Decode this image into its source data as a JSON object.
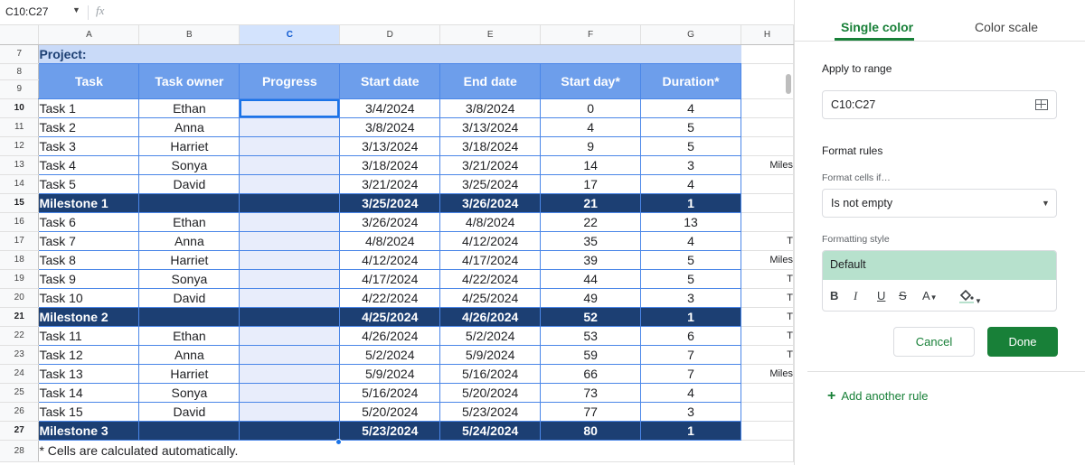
{
  "formula_bar": {
    "name_box": "C10:C27",
    "fx": "fx"
  },
  "columns": [
    "A",
    "B",
    "C",
    "D",
    "E",
    "F",
    "G",
    "H"
  ],
  "rows": {
    "project": {
      "num": "7",
      "label": "Project:"
    },
    "blank8": {
      "num": "8"
    },
    "header": {
      "num": "9",
      "cells": [
        "Task",
        "Task owner",
        "Progress",
        "Start date",
        "End date",
        "Start day*",
        "Duration*"
      ]
    },
    "data": [
      {
        "num": "10",
        "task": "Task 1",
        "owner": "Ethan",
        "start": "3/4/2024",
        "end": "3/8/2024",
        "day": "0",
        "dur": "4",
        "h": ""
      },
      {
        "num": "11",
        "task": "Task 2",
        "owner": "Anna",
        "start": "3/8/2024",
        "end": "3/13/2024",
        "day": "4",
        "dur": "5",
        "h": ""
      },
      {
        "num": "12",
        "task": "Task 3",
        "owner": "Harriet",
        "start": "3/13/2024",
        "end": "3/18/2024",
        "day": "9",
        "dur": "5",
        "h": ""
      },
      {
        "num": "13",
        "task": "Task 4",
        "owner": "Sonya",
        "start": "3/18/2024",
        "end": "3/21/2024",
        "day": "14",
        "dur": "3",
        "h": ""
      },
      {
        "num": "14",
        "task": "Task 5",
        "owner": "David",
        "start": "3/21/2024",
        "end": "3/25/2024",
        "day": "17",
        "dur": "4",
        "h": ""
      },
      {
        "num": "15",
        "task": "Milestone 1",
        "owner": "",
        "start": "3/25/2024",
        "end": "3/26/2024",
        "day": "21",
        "dur": "1",
        "h": "",
        "milestone": true
      },
      {
        "num": "16",
        "task": "Task 6",
        "owner": "Ethan",
        "start": "3/26/2024",
        "end": "4/8/2024",
        "day": "22",
        "dur": "13",
        "h": ""
      },
      {
        "num": "17",
        "task": "Task 7",
        "owner": "Anna",
        "start": "4/8/2024",
        "end": "4/12/2024",
        "day": "35",
        "dur": "4",
        "h": "T"
      },
      {
        "num": "18",
        "task": "Task 8",
        "owner": "Harriet",
        "start": "4/12/2024",
        "end": "4/17/2024",
        "day": "39",
        "dur": "5",
        "h": "Miles"
      },
      {
        "num": "19",
        "task": "Task 9",
        "owner": "Sonya",
        "start": "4/17/2024",
        "end": "4/22/2024",
        "day": "44",
        "dur": "5",
        "h": "T"
      },
      {
        "num": "20",
        "task": "Task 10",
        "owner": "David",
        "start": "4/22/2024",
        "end": "4/25/2024",
        "day": "49",
        "dur": "3",
        "h": "T"
      },
      {
        "num": "21",
        "task": "Milestone 2",
        "owner": "",
        "start": "4/25/2024",
        "end": "4/26/2024",
        "day": "52",
        "dur": "1",
        "h": "T",
        "milestone": true
      },
      {
        "num": "22",
        "task": "Task 11",
        "owner": "Ethan",
        "start": "4/26/2024",
        "end": "5/2/2024",
        "day": "53",
        "dur": "6",
        "h": "T"
      },
      {
        "num": "23",
        "task": "Task 12",
        "owner": "Anna",
        "start": "5/2/2024",
        "end": "5/9/2024",
        "day": "59",
        "dur": "7",
        "h": "T"
      },
      {
        "num": "24",
        "task": "Task 13",
        "owner": "Harriet",
        "start": "5/9/2024",
        "end": "5/16/2024",
        "day": "66",
        "dur": "7",
        "h": "Miles"
      },
      {
        "num": "25",
        "task": "Task 14",
        "owner": "Sonya",
        "start": "5/16/2024",
        "end": "5/20/2024",
        "day": "73",
        "dur": "4",
        "h": ""
      },
      {
        "num": "26",
        "task": "Task 15",
        "owner": "David",
        "start": "5/20/2024",
        "end": "5/23/2024",
        "day": "77",
        "dur": "3",
        "h": ""
      },
      {
        "num": "27",
        "task": "Milestone 3",
        "owner": "",
        "start": "5/23/2024",
        "end": "5/24/2024",
        "day": "80",
        "dur": "1",
        "h": "",
        "milestone": true
      }
    ],
    "note": {
      "num": "28",
      "text": "* Cells are calculated automatically."
    }
  },
  "h_column_extra": {
    "row13": "Miles"
  },
  "panel": {
    "tabs": {
      "single": "Single color",
      "scale": "Color scale"
    },
    "apply_to_range_label": "Apply to range",
    "range_value": "C10:C27",
    "format_rules_label": "Format rules",
    "format_cells_if_label": "Format cells if…",
    "condition_value": "Is not empty",
    "formatting_style_label": "Formatting style",
    "style_preview": "Default",
    "toolbar": {
      "bold": "B",
      "italic": "I",
      "underline": "U",
      "strike": "S",
      "text_color": "A"
    },
    "cancel": "Cancel",
    "done": "Done",
    "add_rule": "Add another rule"
  },
  "colors": {
    "accent_green": "#188038",
    "style_preview_bg": "#b7e1cd",
    "milestone_bg": "#1c3f73",
    "header_bg": "#6d9eeb",
    "project_bg": "#c9daf8",
    "selection_blue": "#1a73e8"
  }
}
